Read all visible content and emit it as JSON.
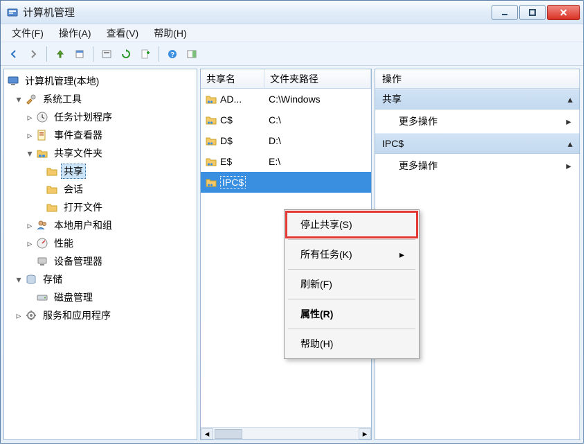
{
  "window": {
    "title": "计算机管理"
  },
  "menubar": {
    "file": "文件(F)",
    "action": "操作(A)",
    "view": "查看(V)",
    "help": "帮助(H)"
  },
  "tree": {
    "root": "计算机管理(本地)",
    "systools": "系统工具",
    "taskscheduler": "任务计划程序",
    "eventviewer": "事件查看器",
    "sharedfolders": "共享文件夹",
    "shares": "共享",
    "sessions": "会话",
    "openfiles": "打开文件",
    "localusers": "本地用户和组",
    "performance": "性能",
    "devicemgr": "设备管理器",
    "storage": "存储",
    "diskmgmt": "磁盘管理",
    "services": "服务和应用程序"
  },
  "shareList": {
    "col_name": "共享名",
    "col_path": "文件夹路径",
    "rows": [
      {
        "name": "AD...",
        "path": "C:\\Windows"
      },
      {
        "name": "C$",
        "path": "C:\\"
      },
      {
        "name": "D$",
        "path": "D:\\"
      },
      {
        "name": "E$",
        "path": "E:\\"
      },
      {
        "name": "IPC$",
        "path": ""
      }
    ],
    "selectedIndex": 4
  },
  "actionsPane": {
    "header": "操作",
    "section1": "共享",
    "more1": "更多操作",
    "section2": "IPC$",
    "more2": "更多操作"
  },
  "contextMenu": {
    "stopShare": "停止共享(S)",
    "allTasks": "所有任务(K)",
    "refresh": "刷新(F)",
    "properties": "属性(R)",
    "help": "帮助(H)"
  }
}
